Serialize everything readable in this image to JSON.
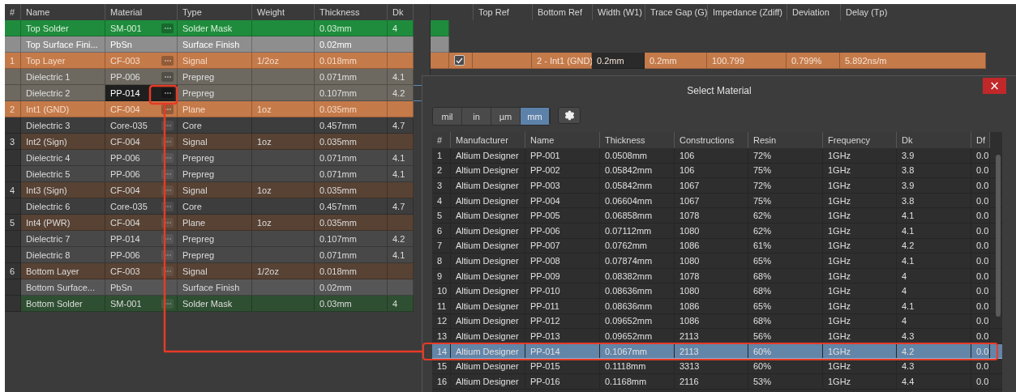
{
  "stack": {
    "columns": [
      "#",
      "Name",
      "Material",
      "Type",
      "Weight",
      "Thickness",
      "Dk"
    ],
    "rows": [
      {
        "name": "Top Solder",
        "material": "SM-001",
        "type": "Solder Mask",
        "thickness": "0.03mm",
        "dk": "4",
        "kind": "mask",
        "highlighted": true,
        "selected": false,
        "picker": true
      },
      {
        "name": "Top Surface Fini...",
        "material": "PbSn",
        "type": "Surface Finish",
        "thickness": "0.02mm",
        "kind": "finish",
        "highlighted": true,
        "selected": false,
        "picker": false
      },
      {
        "number": "1",
        "name": "Top Layer",
        "material": "CF-003",
        "type": "Signal",
        "weight": "1/2oz",
        "thickness": "0.018mm",
        "kind": "copper",
        "highlighted": true,
        "selected": false,
        "picker": true
      },
      {
        "name": "Dielectric 1",
        "material": "PP-006",
        "type": "Prepreg",
        "thickness": "0.071mm",
        "dk": "4.1",
        "kind": "prepreg",
        "highlighted": true,
        "selected": false,
        "picker": true
      },
      {
        "name": "Dielectric 2",
        "material": "PP-014",
        "type": "Prepreg",
        "thickness": "0.107mm",
        "dk": "4.2",
        "kind": "prepreg",
        "highlighted": true,
        "selected": true,
        "picker": true
      },
      {
        "number": "2",
        "name": "Int1 (GND)",
        "material": "CF-004",
        "type": "Plane",
        "weight": "1oz",
        "thickness": "0.035mm",
        "kind": "copper",
        "highlighted": true,
        "selected": false,
        "picker": true
      },
      {
        "name": "Dielectric 3",
        "material": "Core-035",
        "type": "Core",
        "thickness": "0.457mm",
        "dk": "4.7",
        "kind": "core",
        "highlighted": false,
        "selected": false,
        "picker": true
      },
      {
        "number": "3",
        "name": "Int2 (Sign)",
        "material": "CF-004",
        "type": "Signal",
        "weight": "1oz",
        "thickness": "0.035mm",
        "kind": "copper",
        "highlighted": false,
        "selected": false,
        "picker": true
      },
      {
        "name": "Dielectric 4",
        "material": "PP-006",
        "type": "Prepreg",
        "thickness": "0.071mm",
        "dk": "4.1",
        "kind": "prepreg",
        "highlighted": false,
        "selected": false,
        "picker": true
      },
      {
        "name": "Dielectric 5",
        "material": "PP-006",
        "type": "Prepreg",
        "thickness": "0.071mm",
        "dk": "4.1",
        "kind": "prepreg",
        "highlighted": false,
        "selected": false,
        "picker": true
      },
      {
        "number": "4",
        "name": "Int3 (Sign)",
        "material": "CF-004",
        "type": "Signal",
        "weight": "1oz",
        "thickness": "0.035mm",
        "kind": "copper",
        "highlighted": false,
        "selected": false,
        "picker": true
      },
      {
        "name": "Dielectric 6",
        "material": "Core-035",
        "type": "Core",
        "thickness": "0.457mm",
        "dk": "4.7",
        "kind": "core",
        "highlighted": false,
        "selected": false,
        "picker": true
      },
      {
        "number": "5",
        "name": "Int4 (PWR)",
        "material": "CF-004",
        "type": "Plane",
        "weight": "1oz",
        "thickness": "0.035mm",
        "kind": "copper",
        "highlighted": false,
        "selected": false,
        "picker": true
      },
      {
        "name": "Dielectric 7",
        "material": "PP-014",
        "type": "Prepreg",
        "thickness": "0.107mm",
        "dk": "4.2",
        "kind": "prepreg",
        "highlighted": false,
        "selected": false,
        "picker": true
      },
      {
        "name": "Dielectric 8",
        "material": "PP-006",
        "type": "Prepreg",
        "thickness": "0.071mm",
        "dk": "4.1",
        "kind": "prepreg",
        "highlighted": false,
        "selected": false,
        "picker": true
      },
      {
        "number": "6",
        "name": "Bottom Layer",
        "material": "CF-003",
        "type": "Signal",
        "weight": "1/2oz",
        "thickness": "0.018mm",
        "kind": "copper",
        "highlighted": false,
        "selected": false,
        "picker": true
      },
      {
        "name": "Bottom Surface...",
        "material": "PbSn",
        "type": "Surface Finish",
        "thickness": "0.02mm",
        "kind": "finish",
        "highlighted": false,
        "selected": false,
        "picker": false
      },
      {
        "name": "Bottom Solder",
        "material": "SM-001",
        "type": "Solder Mask",
        "thickness": "0.03mm",
        "dk": "4",
        "kind": "mask",
        "highlighted": false,
        "selected": false,
        "picker": true
      }
    ]
  },
  "impedance": {
    "columns": [
      "Top Ref",
      "Bottom Ref",
      "Width (W1)",
      "Trace Gap (G)",
      "Impedance (Zdiff)",
      "Deviation",
      "Delay (Tp)"
    ],
    "rows": [
      {
        "checked": true,
        "bottom_ref": "2 - Int1 (GND)",
        "width": "0.2mm",
        "trace_gap": "0.2mm",
        "impedance": "100.799",
        "deviation": "0.799%",
        "delay": "5.892ns/m"
      }
    ]
  },
  "dialog": {
    "title": "Select Material",
    "close": "×",
    "units": [
      {
        "label": "mil",
        "selected": false
      },
      {
        "label": "in",
        "selected": false
      },
      {
        "label": "µm",
        "selected": false
      },
      {
        "label": "mm",
        "selected": true
      }
    ],
    "columns": [
      "#",
      "Manufacturer",
      "Name",
      "Thickness",
      "Constructions",
      "Resin",
      "Frequency",
      "Dk",
      "Df"
    ],
    "rows": [
      {
        "cells": [
          "1",
          "Altium Designer",
          "PP-001",
          "0.0508mm",
          "106",
          "72%",
          "1GHz",
          "3.9",
          "0.0"
        ],
        "selected": false
      },
      {
        "cells": [
          "2",
          "Altium Designer",
          "PP-002",
          "0.05842mm",
          "106",
          "75%",
          "1GHz",
          "3.8",
          "0.0"
        ],
        "selected": false
      },
      {
        "cells": [
          "3",
          "Altium Designer",
          "PP-003",
          "0.05842mm",
          "1067",
          "72%",
          "1GHz",
          "3.9",
          "0.0"
        ],
        "selected": false
      },
      {
        "cells": [
          "4",
          "Altium Designer",
          "PP-004",
          "0.06604mm",
          "1067",
          "75%",
          "1GHz",
          "3.8",
          "0.0"
        ],
        "selected": false
      },
      {
        "cells": [
          "5",
          "Altium Designer",
          "PP-005",
          "0.06858mm",
          "1078",
          "62%",
          "1GHz",
          "4.1",
          "0.0"
        ],
        "selected": false
      },
      {
        "cells": [
          "6",
          "Altium Designer",
          "PP-006",
          "0.07112mm",
          "1080",
          "62%",
          "1GHz",
          "4.1",
          "0.0"
        ],
        "selected": false
      },
      {
        "cells": [
          "7",
          "Altium Designer",
          "PP-007",
          "0.0762mm",
          "1086",
          "61%",
          "1GHz",
          "4.2",
          "0.0"
        ],
        "selected": false
      },
      {
        "cells": [
          "8",
          "Altium Designer",
          "PP-008",
          "0.07874mm",
          "1080",
          "65%",
          "1GHz",
          "4.1",
          "0.0"
        ],
        "selected": false
      },
      {
        "cells": [
          "9",
          "Altium Designer",
          "PP-009",
          "0.08382mm",
          "1078",
          "68%",
          "1GHz",
          "4",
          "0.0"
        ],
        "selected": false
      },
      {
        "cells": [
          "10",
          "Altium Designer",
          "PP-010",
          "0.08636mm",
          "1080",
          "68%",
          "1GHz",
          "4",
          "0.0"
        ],
        "selected": false
      },
      {
        "cells": [
          "11",
          "Altium Designer",
          "PP-011",
          "0.08636mm",
          "1086",
          "65%",
          "1GHz",
          "4.1",
          "0.0"
        ],
        "selected": false
      },
      {
        "cells": [
          "12",
          "Altium Designer",
          "PP-012",
          "0.09652mm",
          "1086",
          "68%",
          "1GHz",
          "4",
          "0.0"
        ],
        "selected": false
      },
      {
        "cells": [
          "13",
          "Altium Designer",
          "PP-013",
          "0.09652mm",
          "2113",
          "56%",
          "1GHz",
          "4.3",
          "0.0"
        ],
        "selected": false
      },
      {
        "cells": [
          "14",
          "Altium Designer",
          "PP-014",
          "0.1067mm",
          "2113",
          "60%",
          "1GHz",
          "4.2",
          "0.0"
        ],
        "selected": true
      },
      {
        "cells": [
          "15",
          "Altium Designer",
          "PP-015",
          "0.1118mm",
          "3313",
          "60%",
          "1GHz",
          "4.3",
          "0.0"
        ],
        "selected": false
      },
      {
        "cells": [
          "16",
          "Altium Designer",
          "PP-016",
          "0.1168mm",
          "2116",
          "53%",
          "1GHz",
          "4.4",
          "0.0"
        ],
        "selected": false
      }
    ]
  }
}
